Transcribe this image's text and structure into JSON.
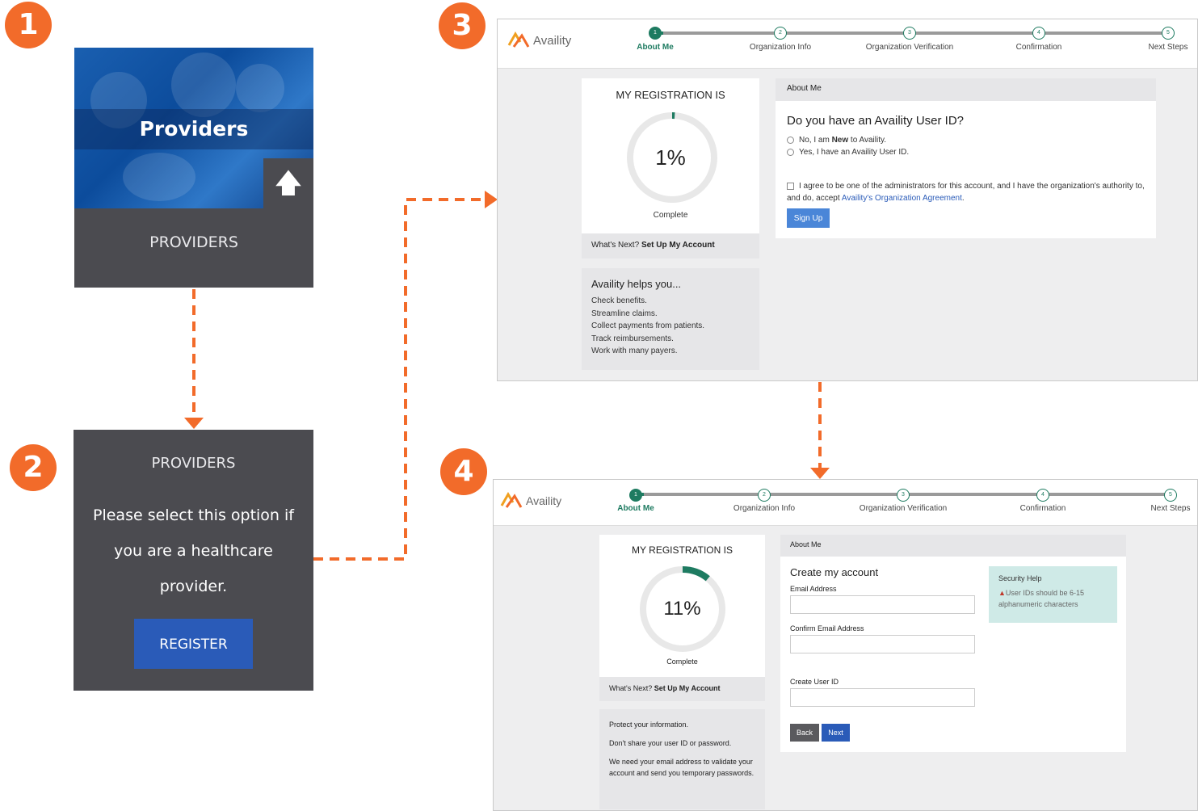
{
  "badges": [
    "1",
    "2",
    "3",
    "4"
  ],
  "colors": {
    "accent": "#f26b2a",
    "dark_panel": "#4b4b50",
    "register_blue": "#2a5bb8",
    "availity_green": "#1e7b61"
  },
  "panel1": {
    "title": "Providers",
    "label": "PROVIDERS",
    "arrow_icon": "up-arrow-icon"
  },
  "panel2": {
    "heading": "PROVIDERS",
    "message": "Please select this option if you are a healthcare provider.",
    "register_label": "REGISTER"
  },
  "brand": {
    "name": "Availity"
  },
  "steps": {
    "labels": [
      "About Me",
      "Organization Info",
      "Organization Verification",
      "Confirmation",
      "Next Steps"
    ],
    "numbers": [
      "1",
      "2",
      "3",
      "4",
      "5"
    ]
  },
  "screen3": {
    "reg_title": "MY REGISTRATION IS",
    "percent": "1%",
    "progress": 0.01,
    "complete": "Complete",
    "whats_next_prefix": "What's Next?",
    "whats_next_value": "Set Up My Account",
    "helps_title": "Availity helps you...",
    "helps_items": [
      "Check benefits.",
      "Streamline claims.",
      "Collect payments from patients.",
      "Track reimbursements.",
      "Work with many payers."
    ],
    "section_header": "About Me",
    "question": "Do you have an Availity User ID?",
    "option1_pre": "No, I am ",
    "option1_bold": "New",
    "option1_post": " to Availity.",
    "option2": "Yes, I have an Availity User ID.",
    "agree_text": "I agree to be one of the administrators for this account, and I have the organization's authority to, and do, accept",
    "agree_link": "Availity's Organization Agreement",
    "agree_end": ".",
    "signup_label": "Sign Up"
  },
  "screen4": {
    "reg_title": "MY REGISTRATION IS",
    "percent": "11%",
    "progress": 0.11,
    "complete": "Complete",
    "whats_next_prefix": "What's Next?",
    "whats_next_value": "Set Up My Account",
    "info_lines": [
      "Protect your information.",
      "Don't share your user ID or password.",
      "We need your email address to validate your account and send you temporary passwords."
    ],
    "section_header": "About Me",
    "form_title": "Create my account",
    "email_label": "Email Address",
    "confirm_label": "Confirm Email Address",
    "userid_label": "Create User ID",
    "back_label": "Back",
    "next_label": "Next",
    "help_title": "Security Help",
    "help_text": "User IDs should be 6-15 alphanumeric characters"
  }
}
